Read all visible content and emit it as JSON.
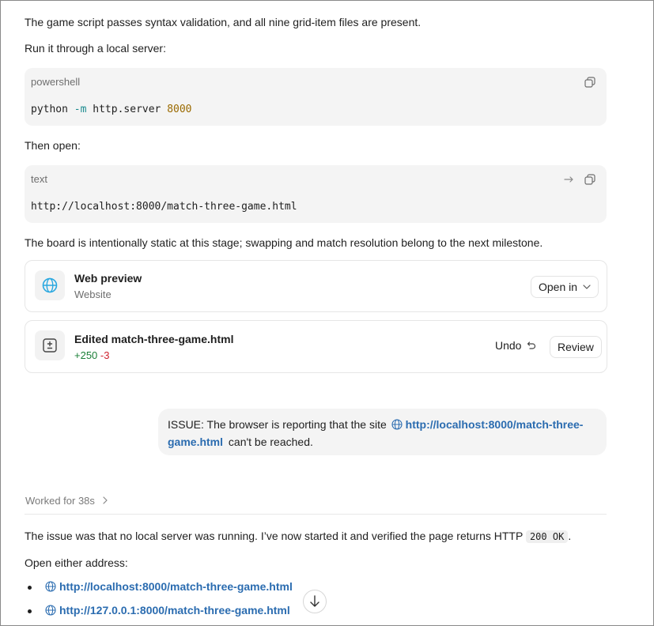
{
  "messages": {
    "intro": "The game script passes syntax validation, and all nine grid-item files are present.",
    "run_label": "Run it through a local server:",
    "code1": {
      "language": "powershell",
      "cmd": "python",
      "flag": "-m",
      "module": "http.server",
      "port": "8000"
    },
    "then_open": "Then open:",
    "code2": {
      "language": "text",
      "url": "http://localhost:8000/match-three-game.html"
    },
    "static_note": "The board is intentionally static at this stage; swapping and match resolution belong to the next milestone."
  },
  "preview_card": {
    "title": "Web preview",
    "subtitle": "Website",
    "open_in_label": "Open in"
  },
  "edit_card": {
    "title": "Edited match-three-game.html",
    "additions": "+250",
    "deletions": "-3",
    "undo_label": "Undo",
    "review_label": "Review"
  },
  "user_message": {
    "prefix": "ISSUE: The browser is reporting that the site",
    "link_part1": "http://localhost:8000/match-three-",
    "link_part2": "game.html",
    "suffix": "can't be reached."
  },
  "worked": {
    "label": "Worked for 38s"
  },
  "reply": {
    "text_before": "The issue was that no local server was running. I’ve now started it and verified the page returns HTTP",
    "status_code": "200 OK",
    "text_after": ".",
    "open_either": "Open either address:",
    "links": [
      "http://localhost:8000/match-three-game.html",
      "http://127.0.0.1:8000/match-three-game.html"
    ]
  },
  "colors": {
    "link": "#2b6cb0",
    "additions": "#1a7f37",
    "deletions": "#cf222e",
    "globe": "#2aa8e0"
  }
}
